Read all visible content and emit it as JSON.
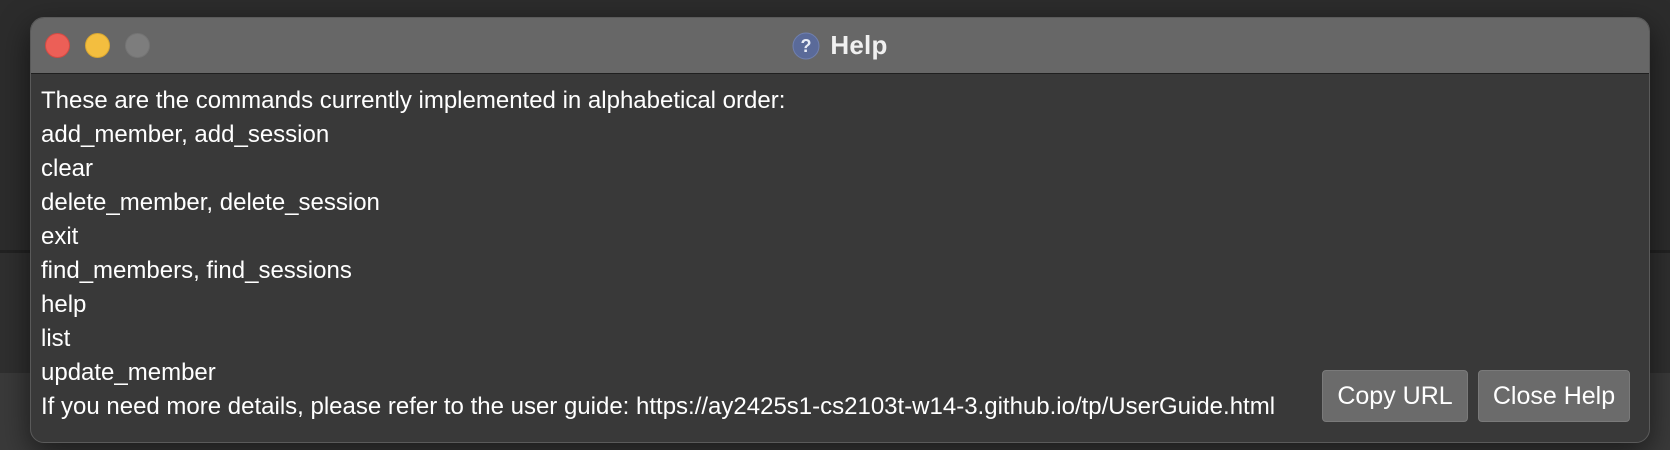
{
  "window": {
    "title": "Help",
    "title_icon": "question-mark-icon",
    "traffic_lights": {
      "close_color": "#ec5f57",
      "minimize_color": "#f3be3f",
      "zoom_color": "#7d7d7d"
    }
  },
  "help": {
    "lines": [
      "These are the commands currently implemented in alphabetical order:",
      "add_member, add_session",
      "clear",
      "delete_member, delete_session",
      "exit",
      "find_members, find_sessions",
      "help",
      "list",
      "update_member",
      "If you need more details, please refer to the user guide: https://ay2425s1-cs2103t-w14-3.github.io/tp/UserGuide.html"
    ]
  },
  "buttons": {
    "copy_url": "Copy URL",
    "close_help": "Close Help"
  },
  "colors": {
    "window_bg": "#393939",
    "titlebar_bg": "#676767",
    "button_bg": "#6b6b6b",
    "text": "#ffffff"
  }
}
